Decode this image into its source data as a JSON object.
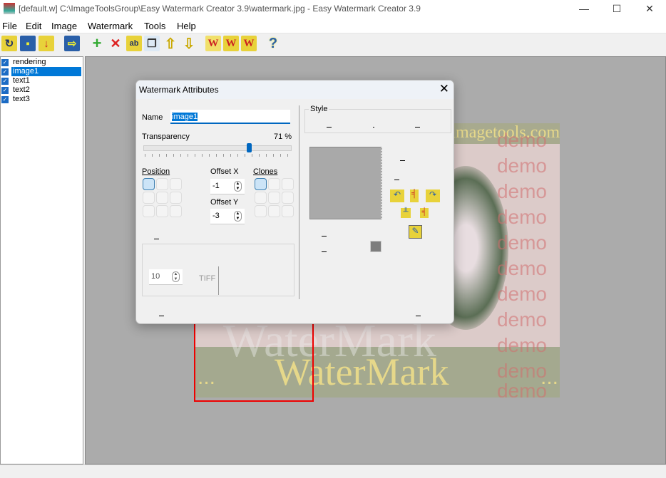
{
  "window": {
    "title": "[default.w] C:\\ImageToolsGroup\\Easy Watermark Creator 3.9\\watermark.jpg - Easy Watermark Creator 3.9",
    "minimize": "—",
    "maximize": "☐",
    "close": "✕"
  },
  "menu": [
    {
      "label": "File"
    },
    {
      "label": "Edit"
    },
    {
      "label": "Image"
    },
    {
      "label": "Watermark"
    },
    {
      "label": "Tools"
    },
    {
      "label": "Help"
    }
  ],
  "toolbar": [
    {
      "icon": "open-project-icon",
      "glyph": "↻"
    },
    {
      "icon": "save-project-icon",
      "glyph": "▪"
    },
    {
      "icon": "import-icon",
      "glyph": "↓"
    },
    {
      "icon": "image-icon",
      "glyph": "⇨"
    },
    {
      "icon": "add-icon",
      "glyph": "+"
    },
    {
      "icon": "delete-icon",
      "glyph": "✕"
    },
    {
      "icon": "text-icon",
      "glyph": "ab"
    },
    {
      "icon": "duplicate-icon",
      "glyph": "❐"
    },
    {
      "icon": "move-up-icon",
      "glyph": "⇧"
    },
    {
      "icon": "move-down-icon",
      "glyph": "⇩"
    },
    {
      "icon": "watermark-file-icon",
      "glyph": "W"
    },
    {
      "icon": "watermark-folder-icon",
      "glyph": "W"
    },
    {
      "icon": "watermark-save-icon",
      "glyph": "W"
    },
    {
      "icon": "help-icon",
      "glyph": "?"
    }
  ],
  "layers": [
    {
      "label": "rendering",
      "checked": true
    },
    {
      "label": "image1",
      "checked": true,
      "selected": true
    },
    {
      "label": "text1",
      "checked": true
    },
    {
      "label": "text2",
      "checked": true
    },
    {
      "label": "text3",
      "checked": true
    }
  ],
  "preview": {
    "banner": "imagetools.com",
    "demo": "demo",
    "watermark_large": "WaterMark",
    "watermark_small": "WaterMark",
    "dots": "..."
  },
  "dialog": {
    "title": "Watermark Attributes",
    "close": "✕",
    "name_label": "Name",
    "name_value": "image1",
    "transparency_label": "Transparency",
    "transparency_value": "71 %",
    "transparency_percent": 71,
    "position_label": "Position",
    "offset_x_label": "Offset X",
    "offset_x_value": "-1",
    "offset_y_label": "Offset Y",
    "offset_y_value": "-3",
    "clones_label": "Clones",
    "size_value": "10",
    "format_label": "TIFF",
    "style_label": "Style"
  }
}
